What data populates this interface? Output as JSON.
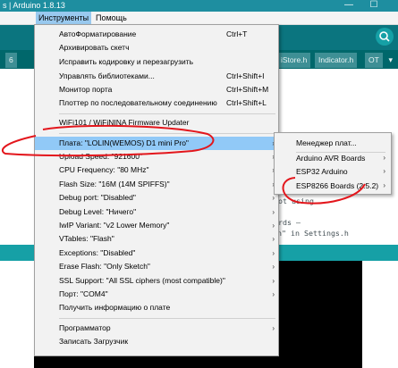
{
  "window": {
    "title": "s | Arduino 1.8.13",
    "minimize": "—",
    "maximize": "☐"
  },
  "menubar": {
    "tools": "Инструменты",
    "help": "Помощь"
  },
  "tabs": {
    "left_marker": "6",
    "items": [
      "iStore.h",
      "Indicator.h",
      "OT"
    ],
    "more": "▾"
  },
  "editor": {
    "line1": "not using",
    "line2": "ards –",
    "line3": "n\" in Settings.h"
  },
  "tools_menu": {
    "items": [
      {
        "label": "АвтоФорматирование",
        "shortcut": "Ctrl+T"
      },
      {
        "label": "Архивировать скетч",
        "shortcut": ""
      },
      {
        "label": "Исправить кодировку и перезагрузить",
        "shortcut": ""
      },
      {
        "label": "Управлять библиотеками...",
        "shortcut": "Ctrl+Shift+I"
      },
      {
        "label": "Монитор порта",
        "shortcut": "Ctrl+Shift+M"
      },
      {
        "label": "Плоттер по последовательному соединению",
        "shortcut": "Ctrl+Shift+L"
      },
      {
        "label": "WiFi101 / WiFiNINA Firmware Updater",
        "shortcut": ""
      },
      {
        "label": "Плата: \"LOLIN(WEMOS) D1 mini Pro\"",
        "submenu": true
      },
      {
        "label": "Upload Speed: \"921600\"",
        "submenu": true
      },
      {
        "label": "CPU Frequency: \"80 MHz\"",
        "submenu": true
      },
      {
        "label": "Flash Size: \"16M (14M SPIFFS)\"",
        "submenu": true
      },
      {
        "label": "Debug port: \"Disabled\"",
        "submenu": true
      },
      {
        "label": "Debug Level: \"Ничего\"",
        "submenu": true
      },
      {
        "label": "IwIP Variant: \"v2 Lower Memory\"",
        "submenu": true
      },
      {
        "label": "VTables: \"Flash\"",
        "submenu": true
      },
      {
        "label": "Exceptions: \"Disabled\"",
        "submenu": true
      },
      {
        "label": "Erase Flash: \"Only Sketch\"",
        "submenu": true
      },
      {
        "label": "SSL Support: \"All SSL ciphers (most compatible)\"",
        "submenu": true
      },
      {
        "label": "Порт: \"COM4\"",
        "submenu": true
      },
      {
        "label": "Получить информацию о плате",
        "shortcut": ""
      },
      {
        "label": "Программатор",
        "submenu": true
      },
      {
        "label": "Записать Загрузчик",
        "shortcut": ""
      }
    ]
  },
  "board_submenu": {
    "items": [
      {
        "label": "Менеджер плат...",
        "submenu": false
      },
      {
        "label": "Arduino AVR Boards",
        "submenu": true
      },
      {
        "label": "ESP32 Arduino",
        "submenu": true
      },
      {
        "label": "ESP8266 Boards (2.5.2)",
        "submenu": true
      }
    ]
  },
  "arrow_glyph": "›",
  "colors": {
    "title_bar": "#1e8ea0",
    "ide_toolbar": "#0b757f",
    "tabs_bar": "#00676b",
    "highlight": "#91c9f7",
    "annotation_red": "#e3161c"
  }
}
